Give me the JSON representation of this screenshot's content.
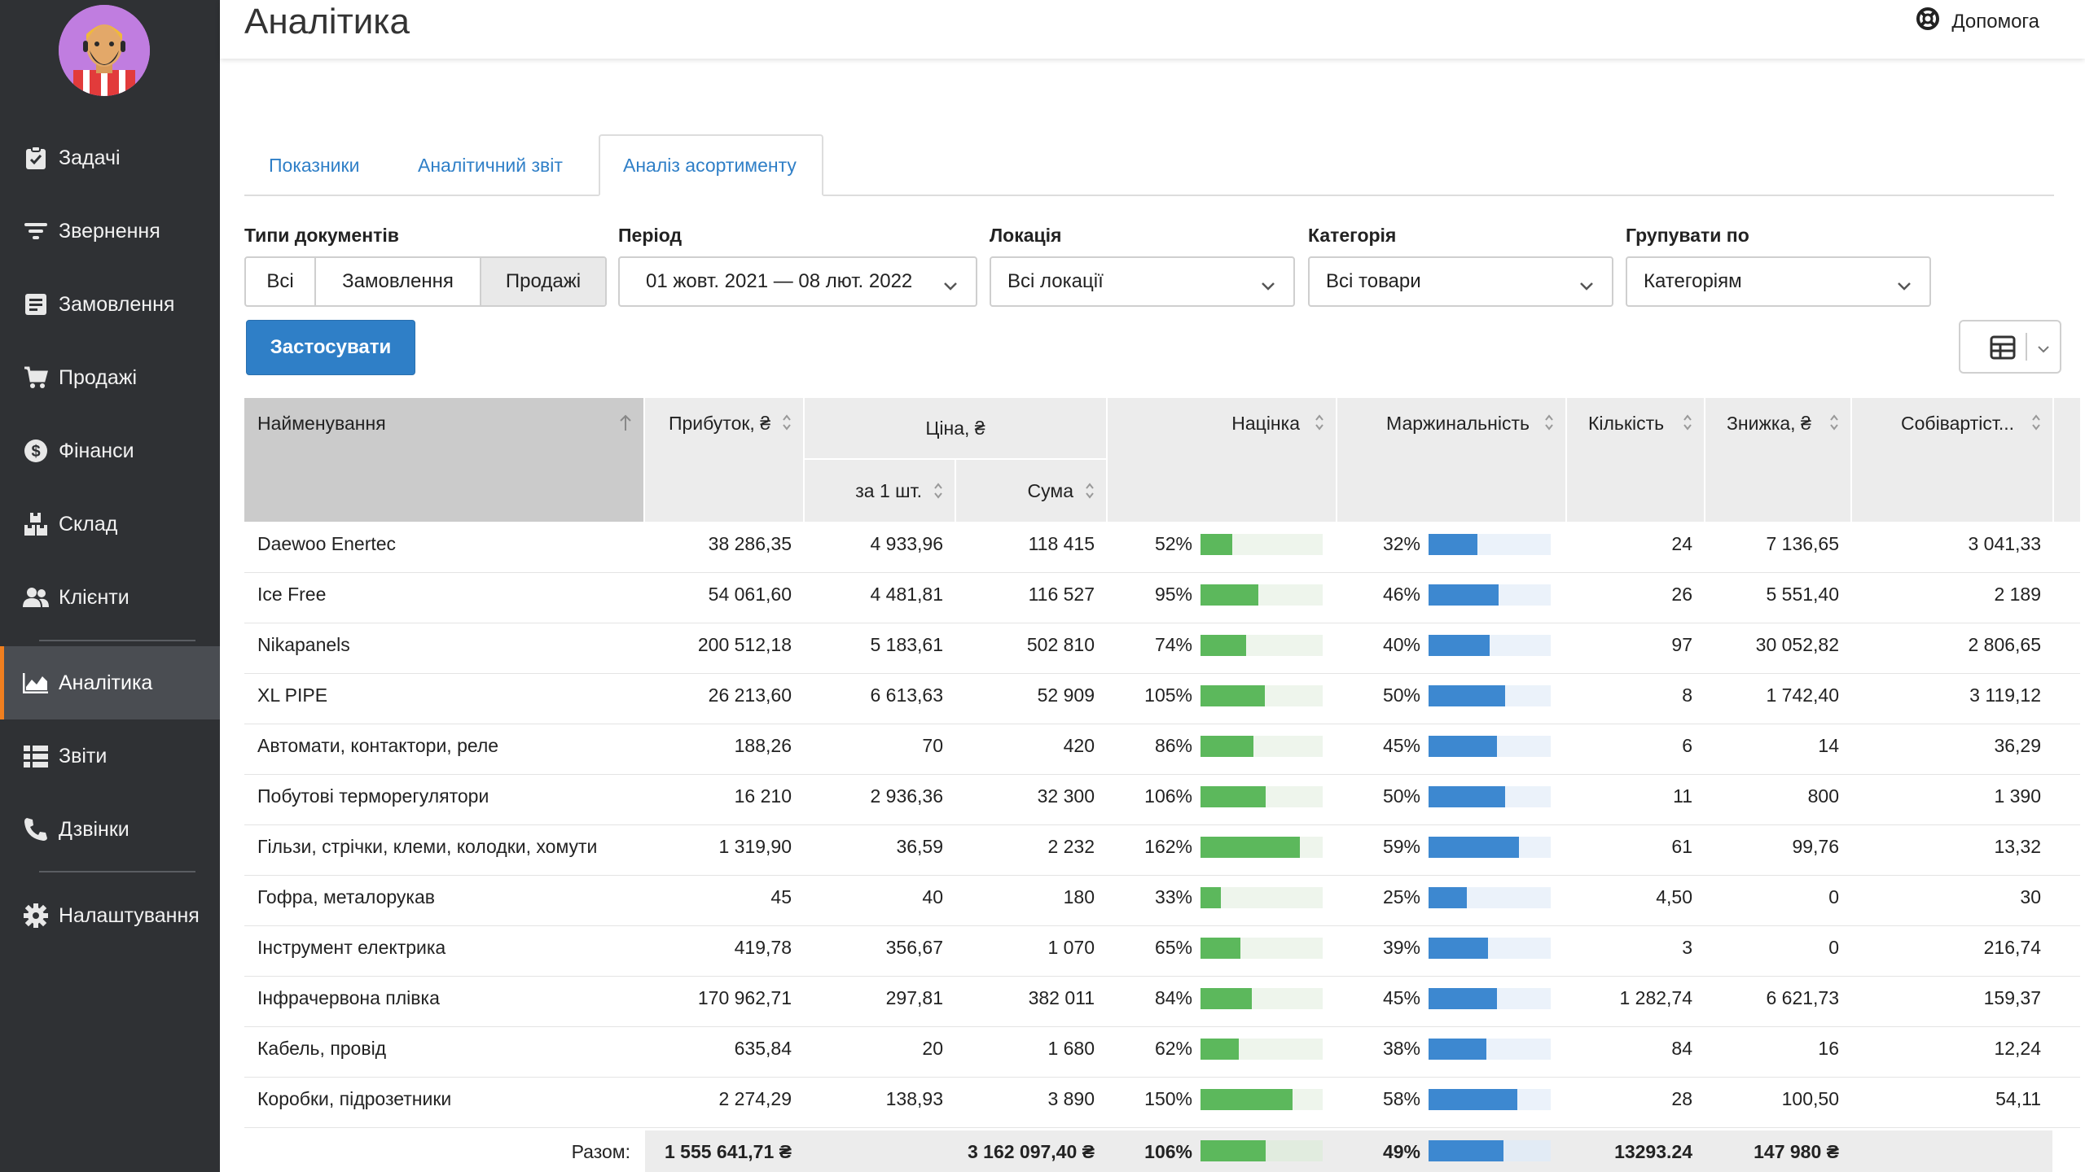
{
  "app": {
    "title": "Аналітика",
    "help": "Допомога"
  },
  "nav": [
    {
      "label": "Задачі",
      "icon": "clipboard-check-icon"
    },
    {
      "label": "Звернення",
      "icon": "filter-lines-icon"
    },
    {
      "label": "Замовлення",
      "icon": "order-list-icon"
    },
    {
      "label": "Продажі",
      "icon": "shopping-cart-icon"
    },
    {
      "label": "Фінанси",
      "icon": "dollar-circle-icon"
    },
    {
      "label": "Склад",
      "icon": "warehouse-boxes-icon"
    },
    {
      "label": "Клієнти",
      "icon": "users-icon"
    },
    {
      "label": "Аналітика",
      "icon": "chart-area-icon",
      "active": true
    },
    {
      "label": "Звіти",
      "icon": "report-list-icon"
    },
    {
      "label": "Дзвінки",
      "icon": "phone-icon"
    },
    {
      "label": "Налаштування",
      "icon": "gear-icon"
    }
  ],
  "tabs": [
    {
      "label": "Показники"
    },
    {
      "label": "Аналітичний звіт"
    },
    {
      "label": "Аналіз асортименту",
      "active": true
    }
  ],
  "filters": {
    "doc_types_label": "Типи документів",
    "doc_types": [
      "Всі",
      "Замовлення",
      "Продажі"
    ],
    "doc_types_selected": "Продажі",
    "period_label": "Період",
    "period_value": "01 жовт. 2021 — 08 лют. 2022",
    "location_label": "Локація",
    "location_value": "Всі локації",
    "category_label": "Категорія",
    "category_value": "Всі товари",
    "group_label": "Групувати по",
    "group_value": "Категоріям",
    "apply_label": "Застосувати"
  },
  "table": {
    "headers": {
      "name": "Найменування",
      "profit": "Прибуток, ₴",
      "price": "Ціна, ₴",
      "unit_price": "за 1 шт.",
      "sum": "Сума",
      "markup": "Націнка",
      "margin": "Маржинальність",
      "qty": "Кількість",
      "discount": "Знижка, ₴",
      "cost": "Собівартіст..."
    },
    "rows": [
      {
        "name": "Daewoo Enertec",
        "profit": "38 286,35",
        "unit_price": "4 933,96",
        "sum": "118 415",
        "markup": "52%",
        "markup_pct": 52,
        "margin": "32%",
        "margin_pct": 32,
        "qty": "24",
        "discount": "7 136,65",
        "cost": "3 041,33"
      },
      {
        "name": "Ice Free",
        "profit": "54 061,60",
        "unit_price": "4 481,81",
        "sum": "116 527",
        "markup": "95%",
        "markup_pct": 95,
        "margin": "46%",
        "margin_pct": 46,
        "qty": "26",
        "discount": "5 551,40",
        "cost": "2 189"
      },
      {
        "name": "Nikapanels",
        "profit": "200 512,18",
        "unit_price": "5 183,61",
        "sum": "502 810",
        "markup": "74%",
        "markup_pct": 74,
        "margin": "40%",
        "margin_pct": 40,
        "qty": "97",
        "discount": "30 052,82",
        "cost": "2 806,65"
      },
      {
        "name": "XL PIPE",
        "profit": "26 213,60",
        "unit_price": "6 613,63",
        "sum": "52 909",
        "markup": "105%",
        "markup_pct": 105,
        "margin": "50%",
        "margin_pct": 50,
        "qty": "8",
        "discount": "1 742,40",
        "cost": "3 119,12"
      },
      {
        "name": "Автомати, контактори, реле",
        "profit": "188,26",
        "unit_price": "70",
        "sum": "420",
        "markup": "86%",
        "markup_pct": 86,
        "margin": "45%",
        "margin_pct": 45,
        "qty": "6",
        "discount": "14",
        "cost": "36,29"
      },
      {
        "name": "Побутові терморегулятори",
        "profit": "16 210",
        "unit_price": "2 936,36",
        "sum": "32 300",
        "markup": "106%",
        "markup_pct": 106,
        "margin": "50%",
        "margin_pct": 50,
        "qty": "11",
        "discount": "800",
        "cost": "1 390"
      },
      {
        "name": "Гільзи, стрічки, клеми, колодки, хомути",
        "profit": "1 319,90",
        "unit_price": "36,59",
        "sum": "2 232",
        "markup": "162%",
        "markup_pct": 162,
        "margin": "59%",
        "margin_pct": 59,
        "qty": "61",
        "discount": "99,76",
        "cost": "13,32"
      },
      {
        "name": "Гофра, металорукав",
        "profit": "45",
        "unit_price": "40",
        "sum": "180",
        "markup": "33%",
        "markup_pct": 33,
        "margin": "25%",
        "margin_pct": 25,
        "qty": "4,50",
        "discount": "0",
        "cost": "30"
      },
      {
        "name": "Інструмент електрика",
        "profit": "419,78",
        "unit_price": "356,67",
        "sum": "1 070",
        "markup": "65%",
        "markup_pct": 65,
        "margin": "39%",
        "margin_pct": 39,
        "qty": "3",
        "discount": "0",
        "cost": "216,74"
      },
      {
        "name": "Інфрачервона плівка",
        "profit": "170 962,71",
        "unit_price": "297,81",
        "sum": "382 011",
        "markup": "84%",
        "markup_pct": 84,
        "margin": "45%",
        "margin_pct": 45,
        "qty": "1 282,74",
        "discount": "6 621,73",
        "cost": "159,37"
      },
      {
        "name": "Кабель, провід",
        "profit": "635,84",
        "unit_price": "20",
        "sum": "1 680",
        "markup": "62%",
        "markup_pct": 62,
        "margin": "38%",
        "margin_pct": 38,
        "qty": "84",
        "discount": "16",
        "cost": "12,24"
      },
      {
        "name": "Коробки, підрозетники",
        "profit": "2 274,29",
        "unit_price": "138,93",
        "sum": "3 890",
        "markup": "150%",
        "markup_pct": 150,
        "margin": "58%",
        "margin_pct": 58,
        "qty": "28",
        "discount": "100,50",
        "cost": "54,11"
      }
    ],
    "totals": {
      "label": "Разом:",
      "profit": "1 555 641,71 ₴",
      "sum": "3 162 097,40 ₴",
      "markup": "106%",
      "markup_pct": 106,
      "margin": "49%",
      "margin_pct": 49,
      "qty": "13293.24",
      "discount": "147 980 ₴"
    }
  },
  "colors": {
    "sidebar_bg": "#2f3134",
    "accent_blue": "#2f7fc7",
    "markup_bar": "#5cb85c",
    "margin_bar": "#3d88d0"
  }
}
